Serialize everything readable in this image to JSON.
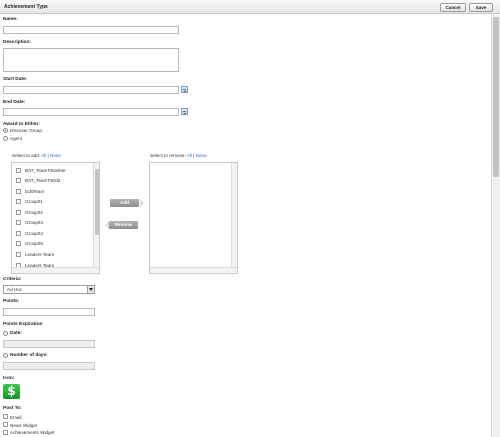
{
  "header": {
    "title": "Achievement Type",
    "cancel_label": "Cancel",
    "save_label": "Save"
  },
  "form": {
    "name_label": "Name:",
    "description_label": "Description:",
    "start_date_label": "Start Date:",
    "end_date_label": "End Date:",
    "award_label": "Award to Either:",
    "award_options": [
      "Discover Group",
      "Agent"
    ],
    "award_selected": "Discover Group",
    "select_to_add_label": "Select to add:",
    "select_to_remove_label": "Select to remove:",
    "all_label": "All",
    "none_label": "None",
    "available_items": [
      "BAT_TeamToDelete",
      "BAT_TeamToEdit",
      "EditTeam",
      "Group01",
      "Group02",
      "Group03",
      "Group04",
      "Group05",
      "Leaders Team",
      "Leaders Team"
    ],
    "add_label": "Add",
    "remove_label": "Remove",
    "criteria_label": "Criteria:",
    "criteria_value": "Ad Hoc",
    "points_label": "Points:",
    "points_expiration_label": "Points Expiration",
    "date_option_label": "Date:",
    "number_of_days_label": "Number of days:",
    "icon_label": "Icon:",
    "icon_symbol": "$",
    "post_to_label": "Post To:",
    "post_to_options": [
      "Email",
      "News Widget",
      "Achievements Widget"
    ]
  },
  "colors": {
    "link": "#2a6cc7",
    "icon_green": "#1fa533"
  }
}
